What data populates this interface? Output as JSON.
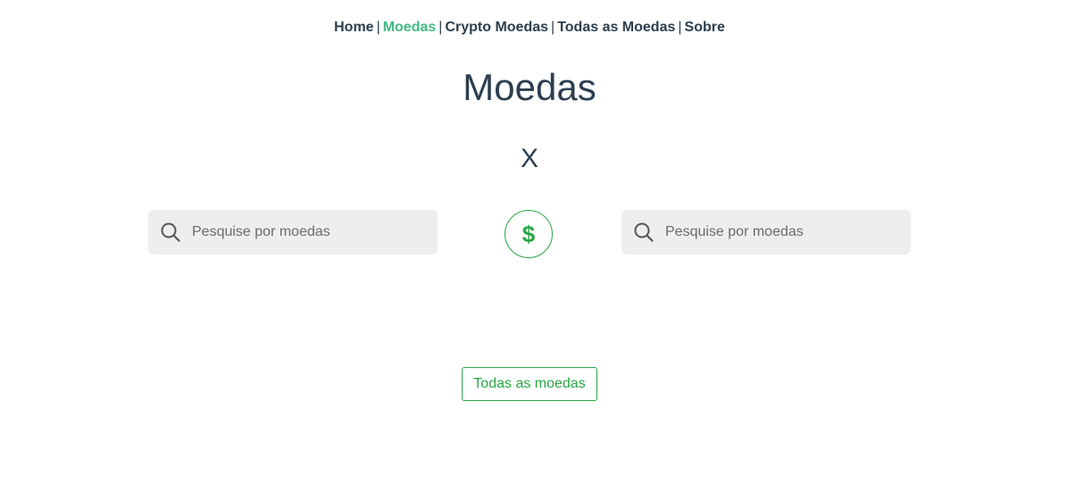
{
  "nav": {
    "items": [
      {
        "label": "Home",
        "active": false
      },
      {
        "label": "Moedas",
        "active": true
      },
      {
        "label": "Crypto Moedas",
        "active": false
      },
      {
        "label": "Todas as Moedas",
        "active": false
      },
      {
        "label": "Sobre",
        "active": false
      }
    ],
    "separator": "|"
  },
  "page": {
    "title": "Moedas",
    "vs_label": "X"
  },
  "search_left": {
    "placeholder": "Pesquise por moedas",
    "value": "",
    "icon": "search-icon"
  },
  "swap_button": {
    "symbol": "$",
    "icon": "dollar-icon"
  },
  "search_right": {
    "placeholder": "Pesquise por moedas",
    "value": "",
    "icon": "search-icon"
  },
  "all_currencies_button": {
    "label": "Todas as moedas"
  },
  "colors": {
    "text": "#2c3e50",
    "active_link": "#42b983",
    "accent": "#28a745",
    "search_bg": "#eeeeee"
  }
}
